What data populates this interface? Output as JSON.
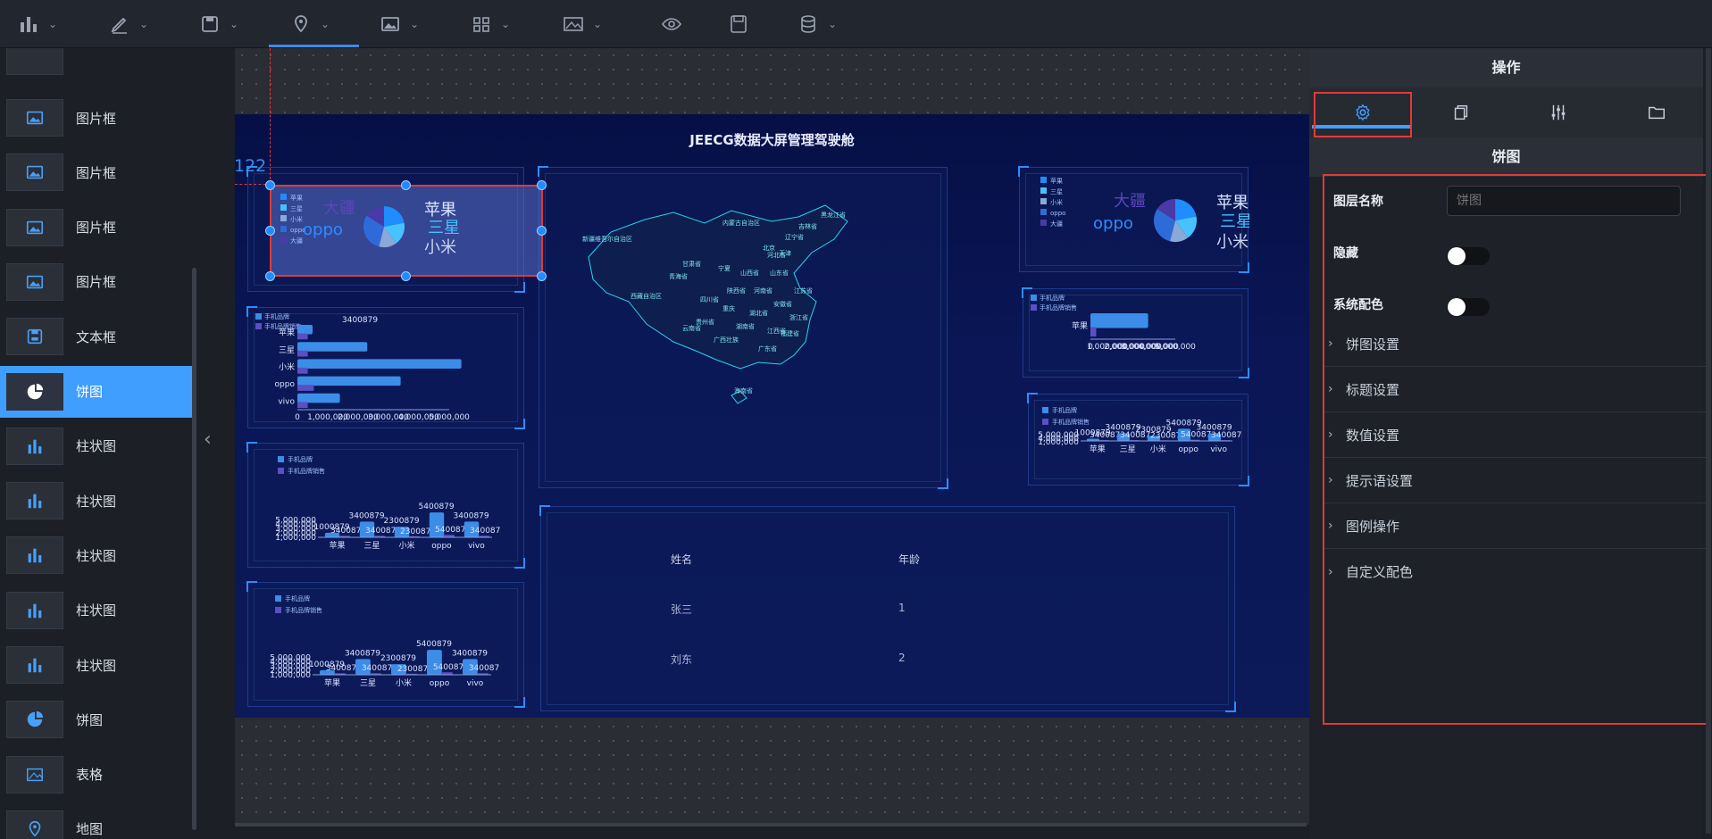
{
  "toolbar": {
    "items": [
      {
        "icon": "bar-chart-icon",
        "dropdown": true
      },
      {
        "icon": "pen-icon",
        "dropdown": true
      },
      {
        "icon": "save-icon",
        "dropdown": true
      },
      {
        "icon": "map-pin-icon",
        "dropdown": true,
        "active": true
      },
      {
        "icon": "image-icon",
        "dropdown": true
      },
      {
        "icon": "grid-icon",
        "dropdown": true
      },
      {
        "icon": "landscape-icon",
        "dropdown": true
      },
      {
        "icon": "eye-icon",
        "dropdown": false
      },
      {
        "icon": "floppy-icon",
        "dropdown": false
      },
      {
        "icon": "database-icon",
        "dropdown": true
      }
    ]
  },
  "sidebar": {
    "items": [
      {
        "label": "图片框",
        "icon": "image-icon"
      },
      {
        "label": "图片框",
        "icon": "image-icon"
      },
      {
        "label": "图片框",
        "icon": "image-icon"
      },
      {
        "label": "图片框",
        "icon": "image-icon"
      },
      {
        "label": "文本框",
        "icon": "text-box-icon"
      },
      {
        "label": "饼图",
        "icon": "pie-chart-icon",
        "active": true
      },
      {
        "label": "柱状图",
        "icon": "bar-chart-icon"
      },
      {
        "label": "柱状图",
        "icon": "bar-chart-icon"
      },
      {
        "label": "柱状图",
        "icon": "bar-chart-icon"
      },
      {
        "label": "柱状图",
        "icon": "bar-chart-icon"
      },
      {
        "label": "柱状图",
        "icon": "bar-chart-icon"
      },
      {
        "label": "饼图",
        "icon": "pie-chart-icon"
      },
      {
        "label": "表格",
        "icon": "table-icon"
      },
      {
        "label": "地图",
        "icon": "map-pin-icon"
      }
    ],
    "collapse_glyph": "‹"
  },
  "canvas": {
    "ruler_label": "122",
    "screen_title": "JEECG数据大屏管理驾驶舱",
    "table": {
      "headers": [
        "姓名",
        "年龄"
      ],
      "rows": [
        [
          "张三",
          "1"
        ],
        [
          "刘东",
          "2"
        ]
      ]
    },
    "map_labels": [
      "内蒙古自治区",
      "新疆维吾尔自治区",
      "甘肃省",
      "青海省",
      "西藏自治区",
      "四川省",
      "云南省",
      "宁夏",
      "陕西省",
      "山西省",
      "河南省",
      "湖北省",
      "湖南省",
      "广西壮族",
      "广东省",
      "贵州省",
      "重庆",
      "福建省",
      "江西省",
      "浙江省",
      "安徽省",
      "江苏省",
      "山东省",
      "河北省",
      "北京",
      "天津",
      "辽宁省",
      "吉林省",
      "黑龙江省",
      "海南省"
    ]
  },
  "chart_data": [
    {
      "type": "pie",
      "id": "pie-selected",
      "legend": [
        "苹果",
        "三星",
        "小米",
        "oppo",
        "大疆"
      ],
      "labels": [
        "大疆",
        "苹果",
        "oppo",
        "三星",
        "小米"
      ]
    },
    {
      "type": "pie",
      "id": "pie-right",
      "legend": [
        "苹果",
        "三星",
        "小米",
        "oppo",
        "大疆"
      ],
      "labels": [
        "大疆",
        "苹果",
        "oppo",
        "三星",
        "小米"
      ]
    },
    {
      "type": "bar",
      "id": "hbar-left",
      "orientation": "horizontal",
      "legend": [
        "手机品牌",
        "手机品牌销售"
      ],
      "categories": [
        "苹果",
        "三星",
        "小米",
        "oppo",
        "vivo"
      ],
      "series": [
        {
          "name": "手机品牌",
          "values": [
            500000,
            2300879,
            5400879,
            3400879,
            1400087
          ]
        },
        {
          "name": "手机品牌销售",
          "values": [
            340087,
            340087,
            340087,
            540087,
            340087
          ]
        }
      ],
      "ticks": [
        "0",
        "1,000,000",
        "2,000,000",
        "3,000,000",
        "4,000,000",
        "5,000,000"
      ],
      "top_label": "3400879",
      "xlim": [
        0,
        5000000
      ]
    },
    {
      "type": "bar",
      "id": "vbar-left-1",
      "legend": [
        "手机品牌",
        "手机品牌销售"
      ],
      "categories": [
        "苹果",
        "三星",
        "小米",
        "oppo",
        "vivo"
      ],
      "series": [
        {
          "name": "手机品牌",
          "values": [
            1000879,
            3400879,
            2300879,
            5400879,
            3400879
          ]
        },
        {
          "name": "手机品牌销售",
          "values": [
            340087,
            340087,
            230087,
            540087,
            340087
          ]
        }
      ],
      "yticks": [
        "5,000,000",
        "4,000,000",
        "3,000,000",
        "2,000,000",
        "1,000,000"
      ],
      "ylim": [
        0,
        5400879
      ]
    },
    {
      "type": "bar",
      "id": "vbar-left-2",
      "legend": [
        "手机品牌",
        "手机品牌销售"
      ],
      "categories": [
        "苹果",
        "三星",
        "小米",
        "oppo",
        "vivo"
      ],
      "series": [
        {
          "name": "手机品牌",
          "values": [
            1000879,
            3400879,
            2300879,
            5400879,
            3400879
          ]
        },
        {
          "name": "手机品牌销售",
          "values": [
            340087,
            340087,
            230087,
            540087,
            340087
          ]
        }
      ],
      "yticks": [
        "5,000,000",
        "4,000,000",
        "3,000,000",
        "2,000,000",
        "1,000,000"
      ],
      "ylim": [
        0,
        5400879
      ]
    },
    {
      "type": "bar",
      "id": "hbar-right",
      "orientation": "horizontal",
      "legend": [
        "手机品牌",
        "手机品牌销售"
      ],
      "categories": [
        "苹果"
      ],
      "series": [
        {
          "name": "手机品牌",
          "values": [
            3400879
          ]
        },
        {
          "name": "手机品牌销售",
          "values": [
            340087
          ]
        }
      ],
      "ticks": [
        "0",
        "1,000,000",
        "2,000,000",
        "3,000,000",
        "4,000,000",
        "5,000,000"
      ],
      "xlim": [
        0,
        5000000
      ]
    },
    {
      "type": "bar",
      "id": "vbar-right",
      "legend": [
        "手机品牌",
        "手机品牌销售"
      ],
      "categories": [
        "苹果",
        "三星",
        "小米",
        "oppo",
        "vivo"
      ],
      "series": [
        {
          "name": "手机品牌",
          "values": [
            1000879,
            3400879,
            2300879,
            5400879,
            3400879
          ]
        },
        {
          "name": "手机品牌销售",
          "values": [
            340087,
            340087,
            230087,
            540087,
            340087
          ]
        }
      ],
      "yticks": [
        "5,000,000",
        "4,000,000",
        "1,000,000"
      ],
      "ylim": [
        0,
        5400879
      ]
    }
  ],
  "colors": {
    "accent": "#409eff",
    "selected_border": "#e03a3a",
    "bar": "#3b8de8",
    "bar2": "#5b4fc4",
    "screen_bg": "#0a1656"
  },
  "rightpanel": {
    "header": "操作",
    "tabs": [
      {
        "icon": "gear-icon",
        "active": true
      },
      {
        "icon": "copy-icon"
      },
      {
        "icon": "sliders-icon"
      },
      {
        "icon": "folder-icon"
      }
    ],
    "subheader": "饼图",
    "fields": {
      "layer_name_label": "图层名称",
      "layer_name_placeholder": "饼图",
      "hidden_label": "隐藏",
      "hidden_value": false,
      "system_color_label": "系统配色",
      "system_color_value": false
    },
    "sections": [
      "饼图设置",
      "标题设置",
      "数值设置",
      "提示语设置",
      "图例操作",
      "自定义配色"
    ]
  }
}
